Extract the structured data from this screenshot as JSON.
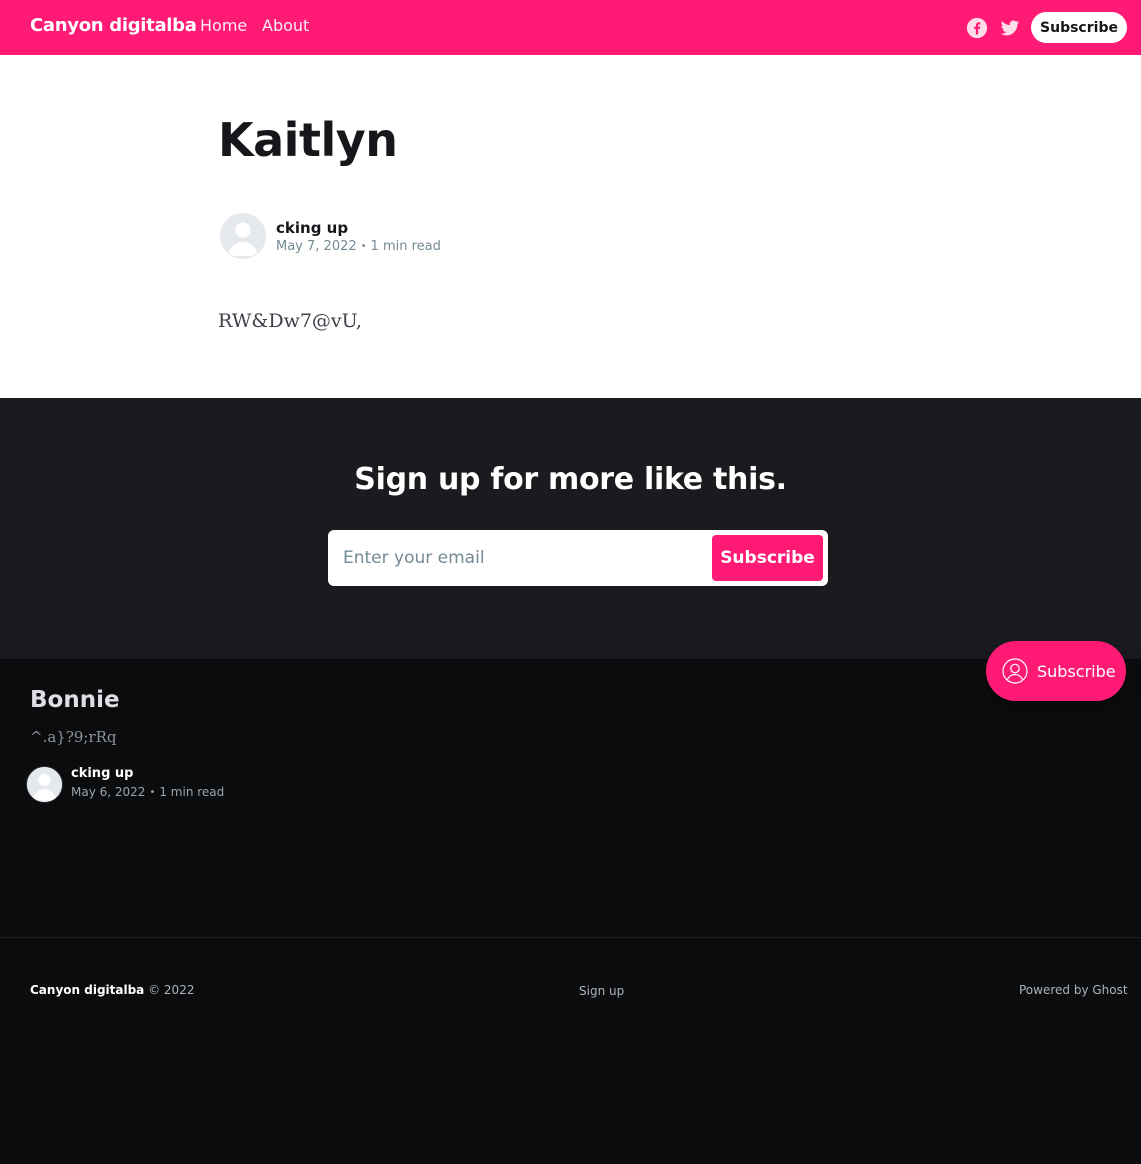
{
  "header": {
    "brand": "Canyon digitalba",
    "nav": [
      "Home",
      "About"
    ],
    "subscribe_label": "Subscribe",
    "social_icons": [
      "facebook-icon",
      "twitter-icon"
    ],
    "accent_color": "#ff1a75"
  },
  "article": {
    "title": "Kaitlyn",
    "author": "cking up",
    "date": "May 7, 2022",
    "reading_time": "1 min read",
    "body": "RW&Dw7@vU,"
  },
  "cta": {
    "title": "Sign up for more like this.",
    "email_placeholder": "Enter your email",
    "button_label": "Subscribe"
  },
  "related": {
    "title": "Bonnie",
    "excerpt": "^.a}?9;rRq",
    "author": "cking up",
    "date": "May 6, 2022",
    "reading_time": "1 min read"
  },
  "footer": {
    "site_name": "Canyon digitalba",
    "copyright": "© 2022",
    "signup_label": "Sign up",
    "powered_by": "Powered by Ghost"
  },
  "portal": {
    "label": "Subscribe"
  }
}
